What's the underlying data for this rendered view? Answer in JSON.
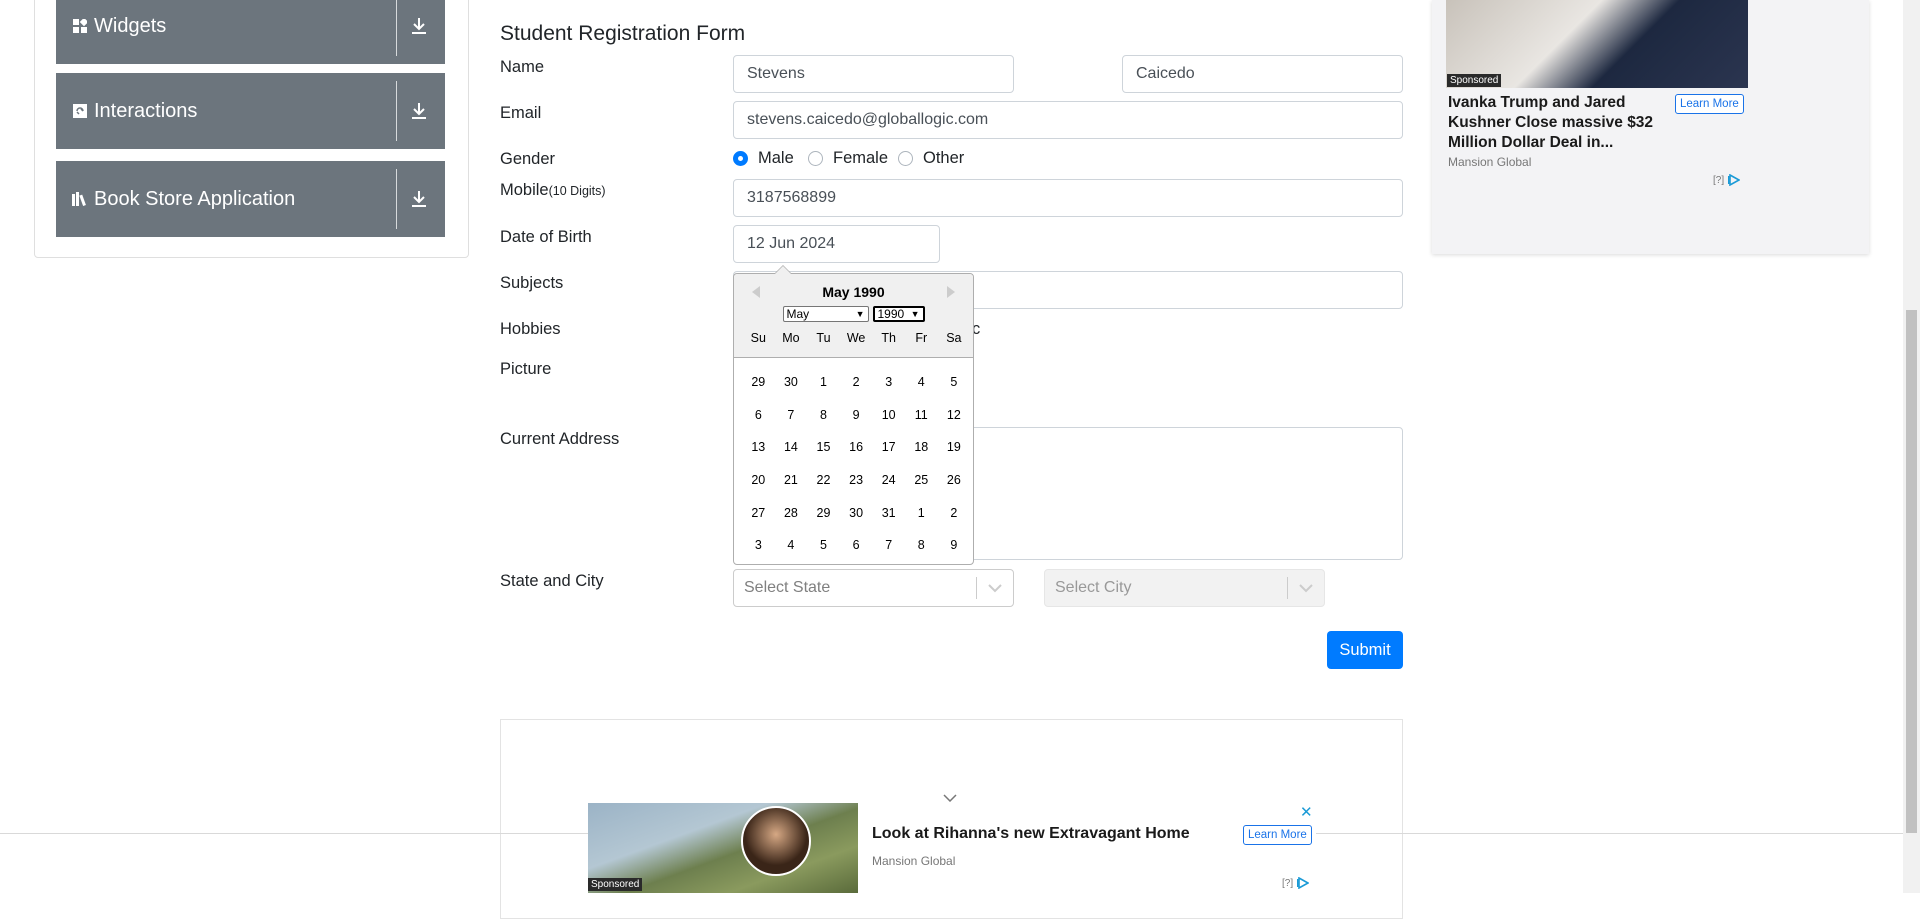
{
  "sidebar": {
    "groups": [
      {
        "label": "Widgets",
        "icon": "widgets-grid-icon"
      },
      {
        "label": "Interactions",
        "icon": "interactions-icon"
      },
      {
        "label": "Book Store Application",
        "icon": "book-icon"
      }
    ]
  },
  "form": {
    "title": "Student Registration Form",
    "labels": {
      "name": "Name",
      "email": "Email",
      "gender": "Gender",
      "mobile": "Mobile",
      "mobile_hint": "(10 Digits)",
      "dob": "Date of Birth",
      "subjects": "Subjects",
      "hobbies": "Hobbies",
      "picture": "Picture",
      "address": "Current Address",
      "state_city": "State and City"
    },
    "first_name": "Stevens",
    "last_name": "Caicedo",
    "email": "stevens.caicedo@globallogic.com",
    "gender_options": [
      "Male",
      "Female",
      "Other"
    ],
    "gender_selected": "Male",
    "mobile": "3187568899",
    "dob": "12 Jun 2024",
    "hobby_partial": "c",
    "state_placeholder": "Select State",
    "city_placeholder": "Select City",
    "submit_label": "Submit",
    "accent_color": "#007bff"
  },
  "datepicker": {
    "current_month": "May 1990",
    "month_select": "May",
    "year_select": "1990",
    "day_names": [
      "Su",
      "Mo",
      "Tu",
      "We",
      "Th",
      "Fr",
      "Sa"
    ],
    "weeks": [
      [
        "29",
        "30",
        "1",
        "2",
        "3",
        "4",
        "5"
      ],
      [
        "6",
        "7",
        "8",
        "9",
        "10",
        "11",
        "12"
      ],
      [
        "13",
        "14",
        "15",
        "16",
        "17",
        "18",
        "19"
      ],
      [
        "20",
        "21",
        "22",
        "23",
        "24",
        "25",
        "26"
      ],
      [
        "27",
        "28",
        "29",
        "30",
        "31",
        "1",
        "2"
      ],
      [
        "3",
        "4",
        "5",
        "6",
        "7",
        "8",
        "9"
      ]
    ]
  },
  "ad_right": {
    "sponsored": "Sponsored",
    "headline": "Ivanka Trump and Jared Kushner Close massive $32 Million Dollar Deal in...",
    "source": "Mansion Global",
    "cta": "Learn More",
    "choice": "[?]"
  },
  "ad_bottom": {
    "sponsored": "Sponsored",
    "headline": "Look at Rihanna's new Extravagant Home",
    "source": "Mansion Global",
    "cta": "Learn More",
    "choice": "[?]"
  }
}
